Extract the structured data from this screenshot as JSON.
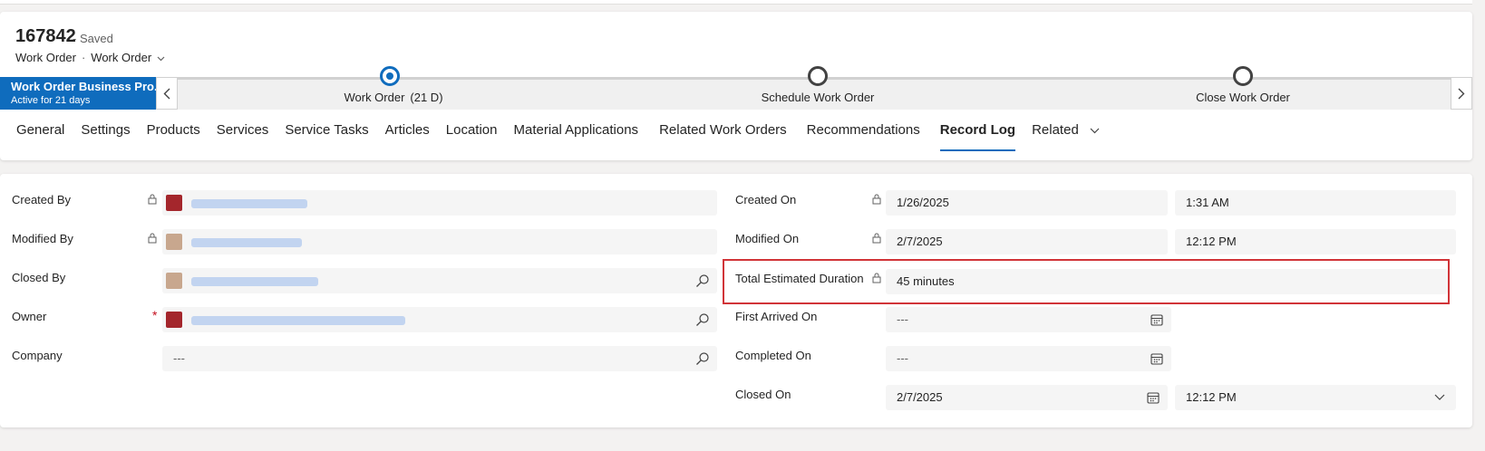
{
  "header": {
    "record_id": "167842",
    "saved_status": "- Saved",
    "entity_name": "Work Order",
    "separator": "·",
    "form_selector": "Work Order"
  },
  "bpf": {
    "process_name": "Work Order Business Pro...",
    "active_text": "Active for 21 days",
    "stages": [
      {
        "name": "Work Order",
        "duration": "(21 D)",
        "active": true
      },
      {
        "name": "Schedule Work Order",
        "duration": "",
        "active": false
      },
      {
        "name": "Close Work Order",
        "duration": "",
        "active": false
      }
    ]
  },
  "tabs": [
    {
      "label": "General"
    },
    {
      "label": "Settings"
    },
    {
      "label": "Products"
    },
    {
      "label": "Services"
    },
    {
      "label": "Service Tasks"
    },
    {
      "label": "Articles"
    },
    {
      "label": "Location"
    },
    {
      "label": "Material Applications"
    },
    {
      "label": "Related Work Orders"
    },
    {
      "label": "Recommendations"
    },
    {
      "label": "Record Log",
      "selected": true
    },
    {
      "label": "Related"
    }
  ],
  "left_fields": [
    {
      "label": "Created By"
    },
    {
      "label": "Modified By"
    },
    {
      "label": "Closed By"
    },
    {
      "label": "Owner",
      "required_mark": "*"
    },
    {
      "label": "Company",
      "value": "---"
    }
  ],
  "right_fields": {
    "created_on": {
      "label": "Created On",
      "date": "1/26/2025",
      "time": "1:31 AM"
    },
    "modified_on": {
      "label": "Modified On",
      "date": "2/7/2025",
      "time": "12:12 PM"
    },
    "total_estimated_duration": {
      "label": "Total Estimated Duration",
      "value": "45 minutes"
    },
    "first_arrived_on": {
      "label": "First Arrived On",
      "value": "---"
    },
    "completed_on": {
      "label": "Completed On",
      "value": "---"
    },
    "closed_on": {
      "label": "Closed On",
      "date": "2/7/2025",
      "time": "12:12 PM"
    }
  },
  "colors": {
    "accent": "#0f6cbd",
    "highlight_border": "#d13438",
    "required": "#c50f1f"
  }
}
